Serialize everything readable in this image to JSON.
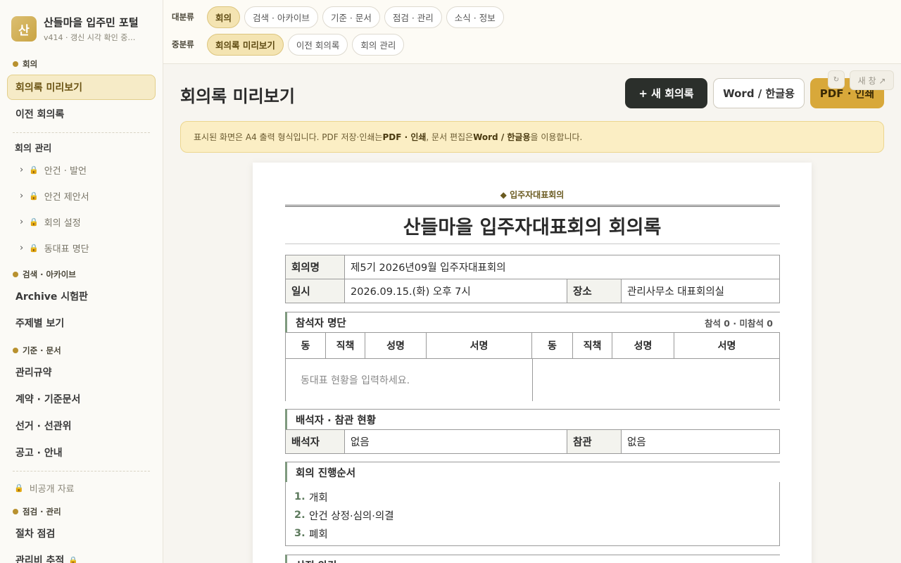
{
  "brand": {
    "logo_char": "산",
    "title": "산들마을 입주민 포털",
    "subtitle": "v414 · 갱신 시각 확인 중…"
  },
  "sidebar": {
    "section_meeting": "회의",
    "items_meeting": [
      "회의록 미리보기",
      "이전 회의록"
    ],
    "manage_label": "회의 관리",
    "manage_children": [
      "안건 · 발언",
      "안건 제안서",
      "회의 설정",
      "동대표 명단"
    ],
    "section_search": "검색 · 아카이브",
    "items_search": [
      "Archive 시험판",
      "주제별 보기"
    ],
    "section_docs": "기준 · 문서",
    "items_docs": [
      "관리규약",
      "계약 · 기준문서",
      "선거 · 선관위",
      "공고 · 안내"
    ],
    "locked_item": "비공개 자료",
    "section_inspect": "점검 · 관리",
    "items_inspect": [
      "절차 점검",
      "관리비 추적"
    ]
  },
  "filters": {
    "major_label": "대분류",
    "major": [
      "회의",
      "검색 · 아카이브",
      "기준 · 문서",
      "점검 · 관리",
      "소식 · 정보"
    ],
    "minor_label": "중분류",
    "minor": [
      "회의록 미리보기",
      "이전 회의록",
      "회의 관리"
    ]
  },
  "main": {
    "title": "회의록 미리보기",
    "btn_new": "+ 새 회의록",
    "btn_word": "Word / 한글용",
    "btn_pdf": "PDF · 인쇄",
    "mini_icon": "↻",
    "mini_window": "새 창 ↗",
    "notice_pre": "표시된 화면은 A4 출력 형식입니다. PDF 저장·인쇄는 ",
    "notice_b1": "PDF · 인쇄",
    "notice_mid": ", 문서 편집은 ",
    "notice_b2": "Word / 한글용",
    "notice_post": "을 이용합니다."
  },
  "paper": {
    "kicker": "◆ 입주자대표회의",
    "title": "산들마을 입주자대표회의 회의록",
    "info": {
      "name_label": "회의명",
      "name_value": "제5기 2026년09월 입주자대표회의",
      "date_label": "일시",
      "date_value": "2026.09.15.(화) 오후 7시",
      "place_label": "장소",
      "place_value": "관리사무소 대표회의실"
    },
    "attendees": {
      "title": "참석자 명단",
      "meta": "참석 0 · 미참석 0",
      "headers": [
        "동",
        "직책",
        "성명",
        "서명",
        "동",
        "직책",
        "성명",
        "서명"
      ],
      "empty": "동대표 현황을 입력하세요."
    },
    "observers": {
      "title": "배석자 · 참관 현황",
      "obs_label": "배석자",
      "obs_value": "없음",
      "vis_label": "참관",
      "vis_value": "없음"
    },
    "agenda": {
      "title": "회의 진행순서",
      "items": [
        {
          "num": "1.",
          "text": "개회"
        },
        {
          "num": "2.",
          "text": "안건 상정·심의·의결"
        },
        {
          "num": "3.",
          "text": "폐회"
        }
      ]
    },
    "next_section": "상정 안건"
  }
}
